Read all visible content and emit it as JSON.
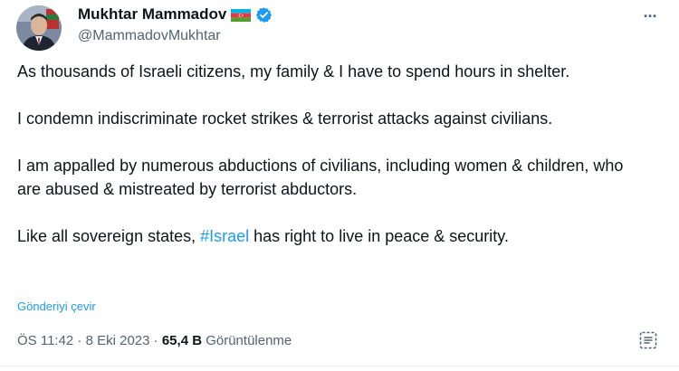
{
  "author": {
    "name": "Mukhtar Mammadov",
    "handle": "@MammadovMukhtar",
    "flag_icon": "azerbaijan-flag-icon",
    "verified_icon": "verified-badge-icon"
  },
  "tweet": {
    "paragraphs": [
      "As thousands of Israeli citizens, my family & I have to spend hours in shelter.",
      "I condemn indiscriminate rocket strikes & terrorist attacks against civilians.",
      "I am appalled by numerous abductions of civilians, including women & children, who are abused & mistreated by terrorist abductors."
    ],
    "last_paragraph": {
      "before": "Like all sovereign states, ",
      "hashtag": "#Israel",
      "after": " has right to live in peace & security."
    },
    "translate_label": "Gönderiyi çevir"
  },
  "meta": {
    "time": "ÖS 11:42",
    "sep1": " · ",
    "date": "8 Eki 2023",
    "sep2": " · ",
    "views_count": "65,4 B",
    "views_label": " Görüntülenme"
  },
  "colors": {
    "accent": "#1d9bf0",
    "text": "#0f1419",
    "secondary": "#536471"
  }
}
